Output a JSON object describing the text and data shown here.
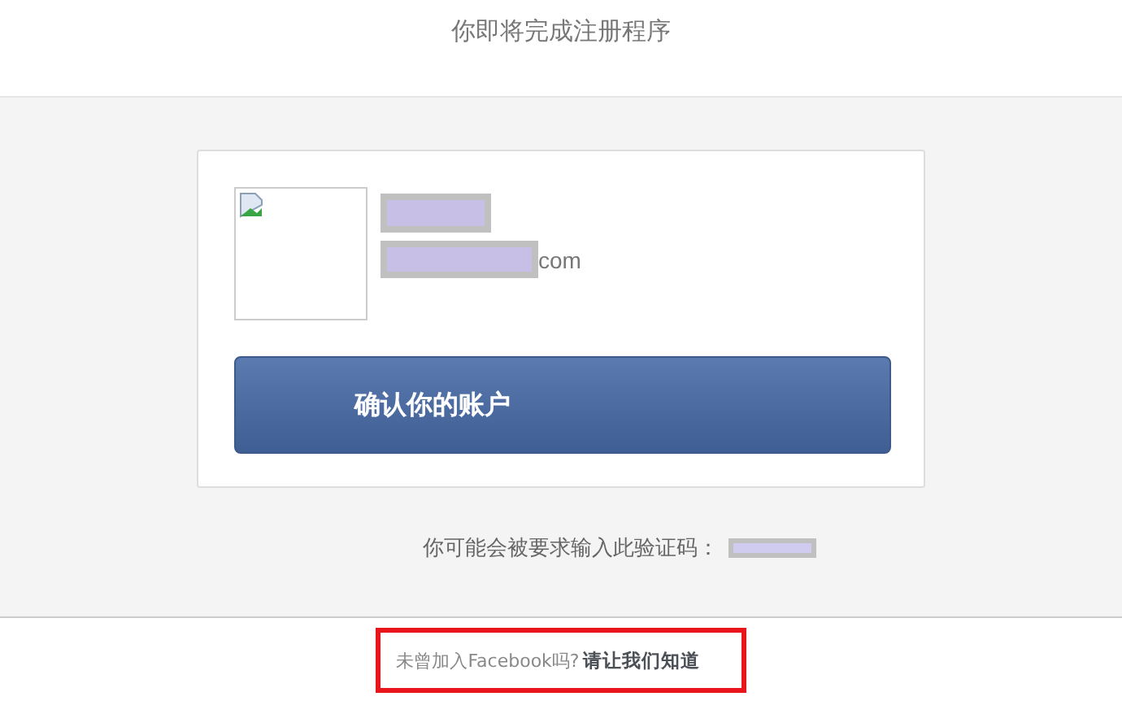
{
  "header": {
    "title": "你即将完成注册程序"
  },
  "account": {
    "email_suffix": "com"
  },
  "confirm_button": {
    "label": "确认你的账户"
  },
  "code_prompt": {
    "label": "你可能会被要求输入此验证码："
  },
  "footer": {
    "question": "未曾加入Facebook吗?",
    "link": "请让我们知道",
    "highlighted": true
  }
}
